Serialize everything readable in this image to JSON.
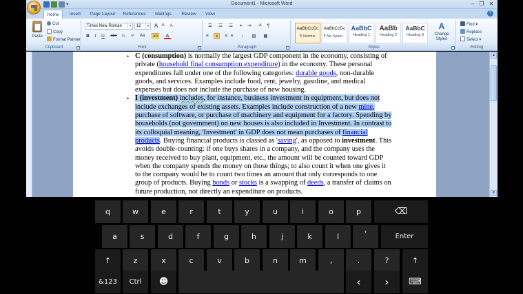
{
  "window": {
    "title": "Document1 - Microsoft Word",
    "minimize": "–",
    "restore": "❐",
    "close": "✕",
    "qat_more": "▾"
  },
  "tabs": [
    "Home",
    "Insert",
    "Page Layout",
    "References",
    "Mailings",
    "Review",
    "View"
  ],
  "help": "?",
  "ribbon": {
    "clipboard": {
      "paste": "Paste",
      "cut": "Cut",
      "copy": "Copy",
      "format_painter": "Format Painter",
      "label": "Clipboard"
    },
    "font": {
      "font_name": "Times New Roman",
      "font_size": "12",
      "grow": "A",
      "shrink": "A",
      "clear": "A",
      "bold": "B",
      "italic": "I",
      "underline": "U",
      "strike": "abe",
      "subscript": "x₂",
      "superscript": "x²",
      "change_case": "Aa",
      "highlight": "ab",
      "font_color": "A",
      "label": "Font"
    },
    "paragraph": {
      "bullets": "☰",
      "numbering": "☷",
      "multilevel": "☳",
      "decrease_indent": "⇤",
      "increase_indent": "⇥",
      "sort": "↓A",
      "show_marks": "¶",
      "align_left": "≡",
      "center": "≡",
      "align_right": "≡",
      "justify": "≡",
      "line_spacing": "↕",
      "shading": "▨",
      "borders": "▦",
      "label": "Paragraph"
    },
    "styles": {
      "items": [
        {
          "sample": "AaBbCcDc",
          "name": "¶ Normal"
        },
        {
          "sample": "AaBbCcDc",
          "name": "¶ No Spaci..."
        },
        {
          "sample": "AaBbC",
          "name": "Heading 1"
        },
        {
          "sample": "AaBb",
          "name": "Heading 2"
        },
        {
          "sample": "AaBbC",
          "name": "Heading 3"
        }
      ],
      "change_styles": "Change Styles",
      "label": "Styles"
    },
    "editing": {
      "find": "Find",
      "replace": "Replace",
      "select": "Select",
      "label": "Editing"
    }
  },
  "document": {
    "bullet_symbol": "•",
    "consumption": {
      "l1_a": "C (consumption)",
      "l1_b": " is normally the largest GDP component in the economy, consisting of",
      "l2_a": "private (",
      "l2_link": "household final consumption expenditure",
      "l2_b": ") in the economy. These personal",
      "l3_a": "expenditures fall under one of the following categories: ",
      "l3_link": "durable goods",
      "l3_b": ", non-durable",
      "l4": "goods, and services. Examples include food, rent, jewelry, gasoline, and medical",
      "l5": "expenses but does not include the purchase of new housing."
    },
    "investment": {
      "l1_a": "I (investment)",
      "l1_b": " ",
      "l1_c": "includes",
      "l1_d": ", for instance, business investment in equipment, but does not",
      "l2": "include exchanges of existing assets. Examples include construction of a new ",
      "l2_link": "mine",
      "l2_b": ",",
      "l3": "purchase of software, or purchase of machinery and equipment for a factory. Spending by",
      "l4": "households (not government) on new houses is also included in Investment. In contrast to",
      "l5_a": "its colloquial meaning, 'Investment' in GDP does not mean purchases of ",
      "l5_link": "financial",
      "l6_link": "products",
      "l6_a": ". Buying financial products is classed as '",
      "l6_link2": "saving",
      "l6_b": "', as opposed to ",
      "l6_bold": "investment",
      "l6_c": ". This",
      "l7": "avoids double-counting: if one buys shares in a company, and the company uses the",
      "l8": "money received to buy plant, equipment, etc., the amount will be counted toward GDP",
      "l9": "when the company spends the money on those things; to also count it when one gives it",
      "l10": "to the company would be to count two times an amount that only corresponds to one",
      "l11_a": "group of products. Buying ",
      "l11_link1": "bonds",
      "l11_b": " or ",
      "l11_link2": "stocks",
      "l11_c": " is a swapping of ",
      "l11_link3": "deeds",
      "l11_d": ", a transfer of claims on",
      "l12": "future production, not directly an expenditure on products."
    }
  },
  "scrollbar": {
    "up": "▲",
    "down": "▼"
  },
  "keyboard": {
    "row1": [
      "q",
      "w",
      "e",
      "r",
      "t",
      "y",
      "u",
      "i",
      "o",
      "p"
    ],
    "backspace": "⌫",
    "row2": [
      "a",
      "s",
      "d",
      "f",
      "g",
      "h",
      "j",
      "k",
      "l",
      "'"
    ],
    "enter": "Enter",
    "shift": "↑",
    "row3": [
      "z",
      "x",
      "c",
      "v",
      "b",
      "n",
      "m",
      ",",
      ".",
      "?"
    ],
    "shift_right": "↑",
    "num": "&123",
    "ctrl": "Ctrl",
    "emoji": "☻",
    "left": "‹",
    "right": "›",
    "kbd": "⌨"
  }
}
